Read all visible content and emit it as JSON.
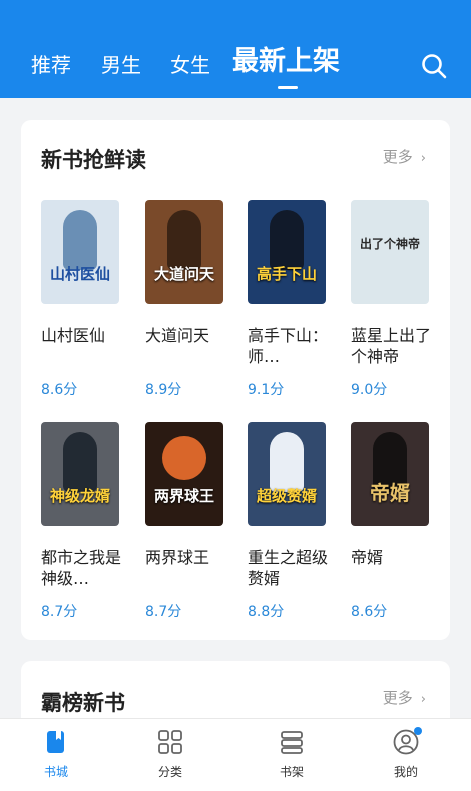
{
  "header": {
    "tabs": [
      "推荐",
      "男生",
      "女生",
      "最新上架"
    ],
    "active_tab": "最新上架",
    "search_icon": "search-icon"
  },
  "section_new": {
    "title": "新书抢鲜读",
    "more": "更多",
    "books": [
      {
        "name": "山村医仙",
        "score": "8.6分",
        "cover_title": "山村医仙",
        "cover_color": "#d9e4ee"
      },
      {
        "name": "大道问天",
        "score": "8.9分",
        "cover_title": "大道问天",
        "cover_color": "#7a4a2a"
      },
      {
        "name": "高手下山：师…",
        "score": "9.1分",
        "cover_title": "高手下山",
        "cover_color": "#1d3d6d"
      },
      {
        "name": "蓝星上出了个神帝",
        "score": "9.0分",
        "cover_title": "出了个神帝",
        "cover_color": "#dce7ec"
      },
      {
        "name": "都市之我是神级…",
        "score": "8.7分",
        "cover_title": "神级龙婿",
        "cover_color": "#5b5f66"
      },
      {
        "name": "两界球王",
        "score": "8.7分",
        "cover_title": "两界球王",
        "cover_color": "#2a1a12"
      },
      {
        "name": "重生之超级赘婿",
        "score": "8.8分",
        "cover_title": "超级赘婿",
        "cover_color": "#324a6e"
      },
      {
        "name": "帝婿",
        "score": "8.6分",
        "cover_title": "帝婿",
        "cover_color": "#3a2e2e"
      }
    ]
  },
  "section_rank": {
    "title": "霸榜新书",
    "more": "更多"
  },
  "bottom_nav": [
    {
      "label": "书城",
      "icon": "bookstore-icon",
      "active": true
    },
    {
      "label": "分类",
      "icon": "category-grid-icon",
      "active": false
    },
    {
      "label": "书架",
      "icon": "bookshelf-icon",
      "active": false
    },
    {
      "label": "我的",
      "icon": "profile-icon",
      "active": false
    }
  ],
  "colors": {
    "primary": "#1a87ec",
    "score": "#2b88d8",
    "background": "#f2f3f5"
  }
}
